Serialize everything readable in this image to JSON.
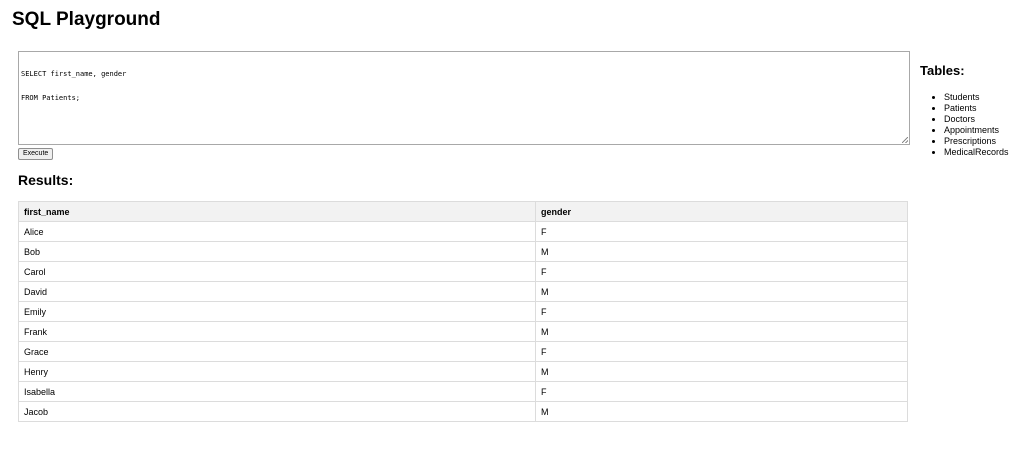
{
  "page": {
    "title": "SQL Playground"
  },
  "editor": {
    "lines": [
      "SELECT first_name, gender",
      "FROM Patients;"
    ]
  },
  "toolbar": {
    "execute_label": "Execute"
  },
  "results": {
    "heading": "Results:",
    "columns": [
      "first_name",
      "gender"
    ],
    "rows": [
      [
        "Alice",
        "F"
      ],
      [
        "Bob",
        "M"
      ],
      [
        "Carol",
        "F"
      ],
      [
        "David",
        "M"
      ],
      [
        "Emily",
        "F"
      ],
      [
        "Frank",
        "M"
      ],
      [
        "Grace",
        "F"
      ],
      [
        "Henry",
        "M"
      ],
      [
        "Isabella",
        "F"
      ],
      [
        "Jacob",
        "M"
      ]
    ]
  },
  "tables_panel": {
    "heading": "Tables:",
    "items": [
      "Students",
      "Patients",
      "Doctors",
      "Appointments",
      "Prescriptions",
      "MedicalRecords"
    ]
  },
  "colors": {
    "header_bg": "#f2f2f2",
    "border": "#dcdcdc"
  }
}
